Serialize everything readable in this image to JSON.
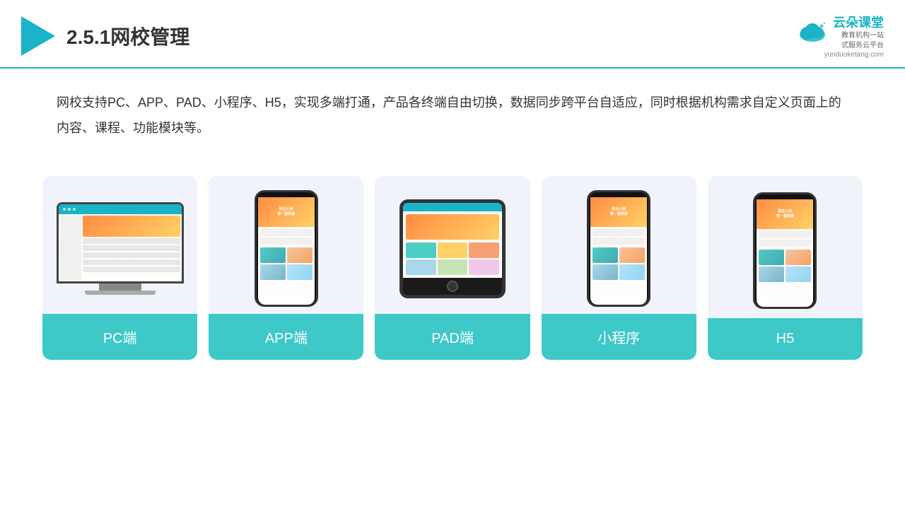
{
  "header": {
    "title": "2.5.1网校管理",
    "brand_name": "云朵课堂",
    "brand_url": "yunduoketang.com",
    "brand_tagline": "教育机构一站\n式服务云平台"
  },
  "description": {
    "text": "网校支持PC、APP、PAD、小程序、H5，实现多端打通，产品各终端自由切换，数据同步跨平台自适应，同时根据机构需求自定义页面上的内容、课程、功能模块等。"
  },
  "cards": [
    {
      "id": "pc",
      "label": "PC端"
    },
    {
      "id": "app",
      "label": "APP端"
    },
    {
      "id": "pad",
      "label": "PAD端"
    },
    {
      "id": "miniprogram",
      "label": "小程序"
    },
    {
      "id": "h5",
      "label": "H5"
    }
  ],
  "colors": {
    "primary": "#1ab3c8",
    "card_bg": "#eef3fa",
    "card_label_bg": "#3ec8c8"
  }
}
